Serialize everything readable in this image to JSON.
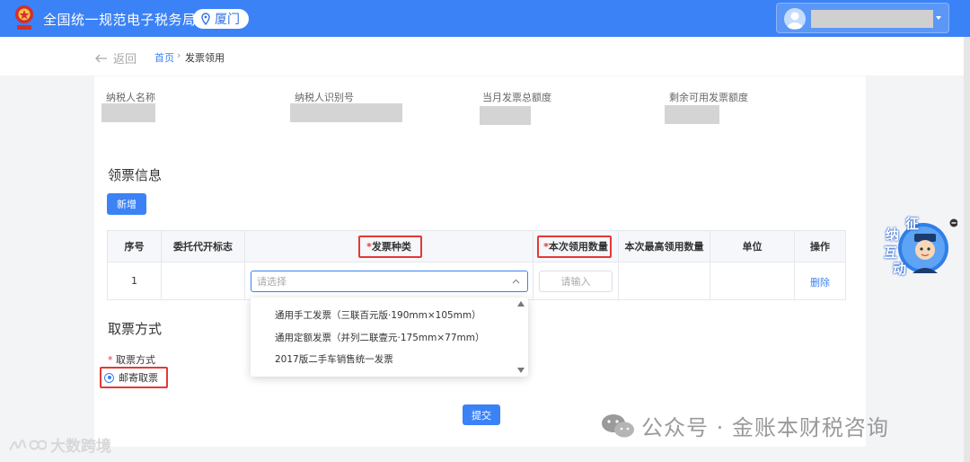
{
  "header": {
    "title": "全国统一规范电子税务局",
    "city": "厦门"
  },
  "breadcrumb": {
    "back": "返回",
    "home": "首页",
    "separator": "›",
    "current": "发票领用"
  },
  "taxpayer_info": {
    "name_label": "纳税人名称",
    "id_label": "纳税人识别号",
    "monthly_quota_label": "当月发票总额度",
    "remaining_quota_label": "剩余可用发票额度"
  },
  "section_invoice": {
    "title": "领票信息",
    "add_button": "新增"
  },
  "table": {
    "headers": {
      "index": "序号",
      "agent_flag": "委托代开标志",
      "required_mark": "*",
      "invoice_type": "发票种类",
      "quantity": "本次领用数量",
      "max_quantity": "本次最高领用数量",
      "unit": "单位",
      "action": "操作"
    },
    "row": {
      "index": "1",
      "select_placeholder": "请选择",
      "qty_placeholder": "请输入",
      "delete": "删除"
    }
  },
  "dropdown": {
    "options": [
      "通用手工发票（三联百元版·190mm×105mm）",
      "通用定额发票（并列二联壹元·175mm×77mm）",
      "2017版二手车销售统一发票"
    ]
  },
  "section_pickup": {
    "title": "取票方式",
    "required_mark": "*",
    "field_label": "取票方式",
    "option_mail": "邮寄取票"
  },
  "submit": "提交",
  "widget": {
    "c1": "征",
    "c2": "纳",
    "c3": "互",
    "c4": "动"
  },
  "watermarks": {
    "left": "大数跨境",
    "right": "公众号 · 金账本财税咨询"
  },
  "colors": {
    "primary": "#3b82f6",
    "highlight": "#e53935"
  }
}
